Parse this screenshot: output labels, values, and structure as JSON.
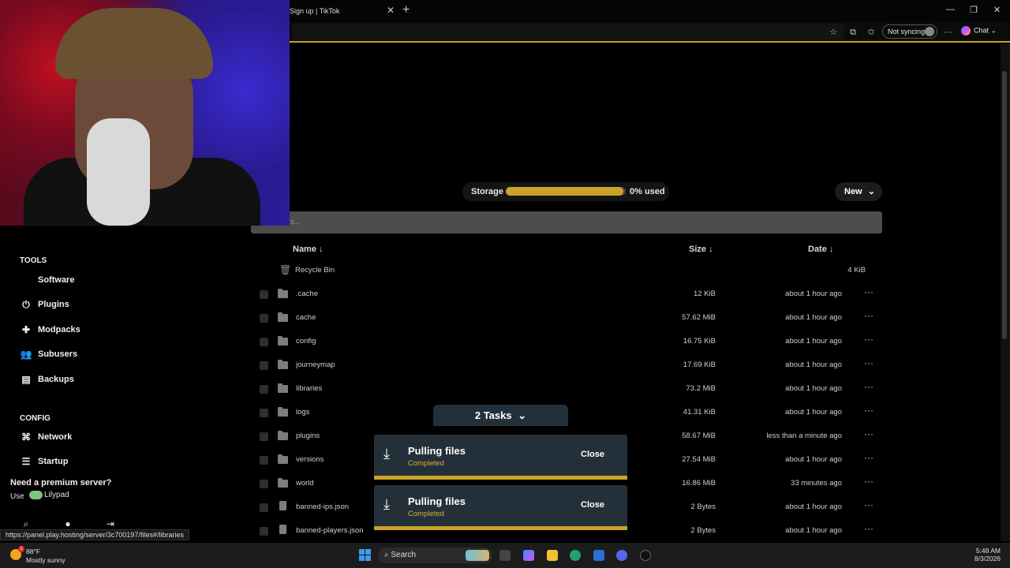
{
  "browser": {
    "tab_title": "Sign up | TikTok",
    "not_syncing": "Not syncing",
    "chat_label": "Chat"
  },
  "storage": {
    "label": "Storage",
    "used_text": "0% used",
    "fill_fraction": 0.98
  },
  "new_button": "New",
  "search_placeholder": "s...",
  "table": {
    "headers": {
      "name": "Name ↓",
      "size": "Size ↓",
      "date": "Date ↓"
    },
    "recycle": {
      "name": "Recycle Bin",
      "size": "4 KiB"
    },
    "rows": [
      {
        "name": ".cache",
        "size": "12 KiB",
        "date": "about 1 hour ago",
        "type": "folder"
      },
      {
        "name": "cache",
        "size": "57.62 MiB",
        "date": "about 1 hour ago",
        "type": "folder"
      },
      {
        "name": "config",
        "size": "16.75 KiB",
        "date": "about 1 hour ago",
        "type": "folder"
      },
      {
        "name": "journeymap",
        "size": "17.69 KiB",
        "date": "about 1 hour ago",
        "type": "folder"
      },
      {
        "name": "libraries",
        "size": "73.2 MiB",
        "date": "about 1 hour ago",
        "type": "folder"
      },
      {
        "name": "logs",
        "size": "41.31 KiB",
        "date": "about 1 hour ago",
        "type": "folder"
      },
      {
        "name": "plugins",
        "size": "58.67 MiB",
        "date": "less than a minute ago",
        "type": "folder"
      },
      {
        "name": "versions",
        "size": "27.54 MiB",
        "date": "about 1 hour ago",
        "type": "folder"
      },
      {
        "name": "world",
        "size": "16.86 MiB",
        "date": "33 minutes ago",
        "type": "folder"
      },
      {
        "name": "banned-ips.json",
        "size": "2 Bytes",
        "date": "about 1 hour ago",
        "type": "file"
      },
      {
        "name": "banned-players.json",
        "size": "2 Bytes",
        "date": "about 1 hour ago",
        "type": "file"
      }
    ]
  },
  "sidebar": {
    "tools_heading": "TOOLS",
    "tools": [
      {
        "label": "Software",
        "icon": "code-icon"
      },
      {
        "label": "Plugins",
        "icon": "plug-icon"
      },
      {
        "label": "Modpacks",
        "icon": "puzzle-icon"
      },
      {
        "label": "Subusers",
        "icon": "users-icon"
      },
      {
        "label": "Backups",
        "icon": "database-icon"
      }
    ],
    "config_heading": "CONFIG",
    "config": [
      {
        "label": "Network",
        "icon": "network-icon"
      },
      {
        "label": "Startup",
        "icon": "sliders-icon"
      }
    ],
    "premium": "Need a premium server?",
    "use": "Use",
    "lilypad": "Lilypad"
  },
  "tasks": {
    "pill": "2 Tasks",
    "items": [
      {
        "title": "Pulling files",
        "status": "Completed",
        "close": "Close"
      },
      {
        "title": "Pulling files",
        "status": "Completed",
        "close": "Close"
      }
    ]
  },
  "status_url": "https://panel.play.hosting/server/3c700197/files#/libraries",
  "taskbar": {
    "temp": "88°F",
    "weather": "Mostly sunny",
    "weather_badge": "1",
    "search": "Search",
    "time": "5:48 AM",
    "date": "8/3/2026"
  },
  "colors": {
    "accent": "#c9a227",
    "task_bg": "#243039",
    "status_completed": "#d4ad3a"
  }
}
